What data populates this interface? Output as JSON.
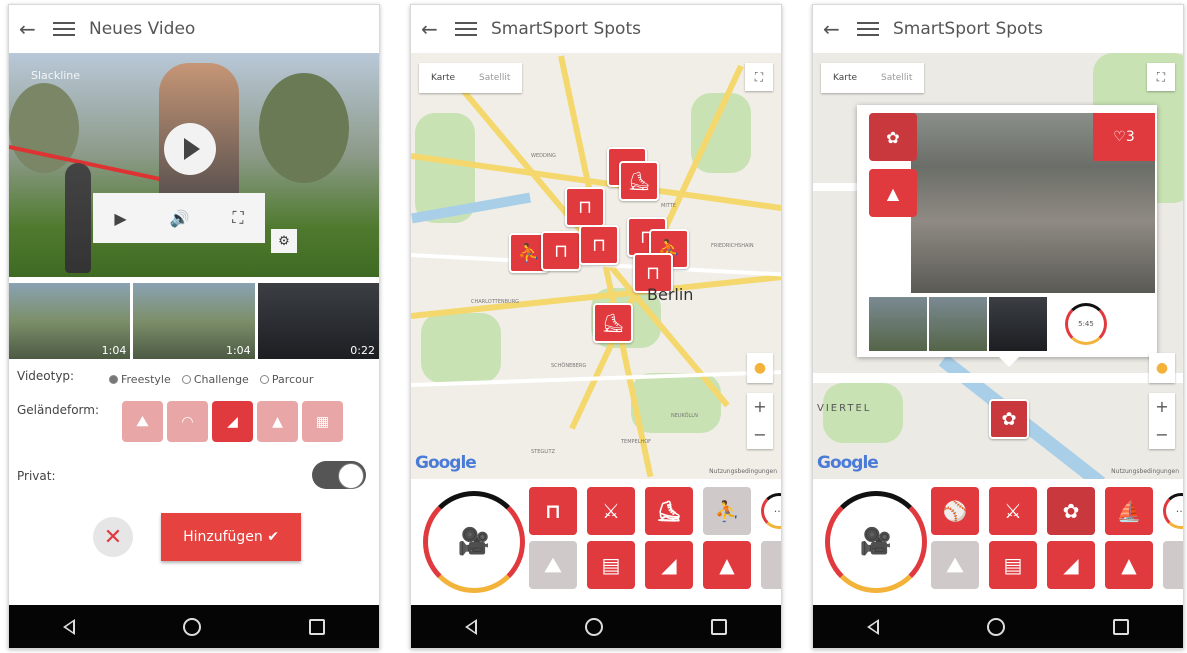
{
  "nav": {
    "back_icon": "triangle-back-icon",
    "home_icon": "circle-home-icon",
    "recent_icon": "square-recent-icon"
  },
  "screen1": {
    "title": "Neues Video",
    "video_label": "Slackline",
    "thumbs": [
      {
        "duration": "1:04"
      },
      {
        "duration": "1:04"
      },
      {
        "duration": "0:22"
      }
    ],
    "videotype_label": "Videotyp:",
    "videotype_options": [
      "Freestyle",
      "Challenge",
      "Parcour"
    ],
    "videotype_selected": "Freestyle",
    "terrain_label": "Geländeform:",
    "private_label": "Privat:",
    "cancel_icon": "✕",
    "add_label": "Hinzufügen ✔"
  },
  "screen2": {
    "title": "SmartSport Spots",
    "map_tabs": [
      "Karte",
      "Satellit"
    ],
    "city_label": "Berlin",
    "google": "Google",
    "map_footer": "Nutzungsbedingungen",
    "zoom_in": "+",
    "zoom_out": "−",
    "streets": [
      "CHARLOTTENBURG",
      "WEDDING",
      "MITTE",
      "FRIEDRICHSHAIN",
      "SCHÖNEBERG",
      "NEUKÖLLN",
      "STEGLITZ",
      "TEMPELHOF"
    ]
  },
  "screen3": {
    "title": "SmartSport Spots",
    "map_tabs": [
      "Karte",
      "Satellit"
    ],
    "likes": "♡3",
    "badge": "5:45",
    "viertel": "VIERTEL",
    "google": "Google",
    "map_footer": "Nutzungsbedingungen",
    "zoom_in": "+",
    "zoom_out": "−"
  },
  "colors": {
    "accent": "#e03a3e",
    "yellow": "#f3b33b",
    "map_bg": "#f1eee7",
    "park": "#c8e2b3"
  }
}
